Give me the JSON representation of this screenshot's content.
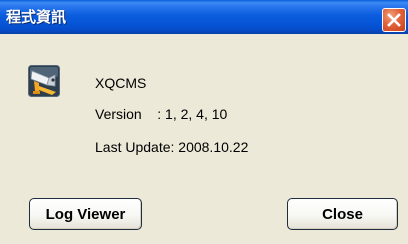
{
  "window": {
    "title": "程式資訊"
  },
  "about": {
    "app_name": "XQCMS",
    "version_label": "Version",
    "version_value": ": 1, 2, 4, 10",
    "last_update_label": "Last Update:",
    "last_update_value": "2008.10.22"
  },
  "buttons": {
    "log_viewer_label": "Log Viewer",
    "close_label": "Close"
  },
  "icons": {
    "app_icon": "security-camera-icon",
    "close": "close-icon"
  },
  "colors": {
    "titlebar_blue": "#0553D4",
    "close_button_red": "#E2633A",
    "dialog_background": "#ECE9D8"
  }
}
